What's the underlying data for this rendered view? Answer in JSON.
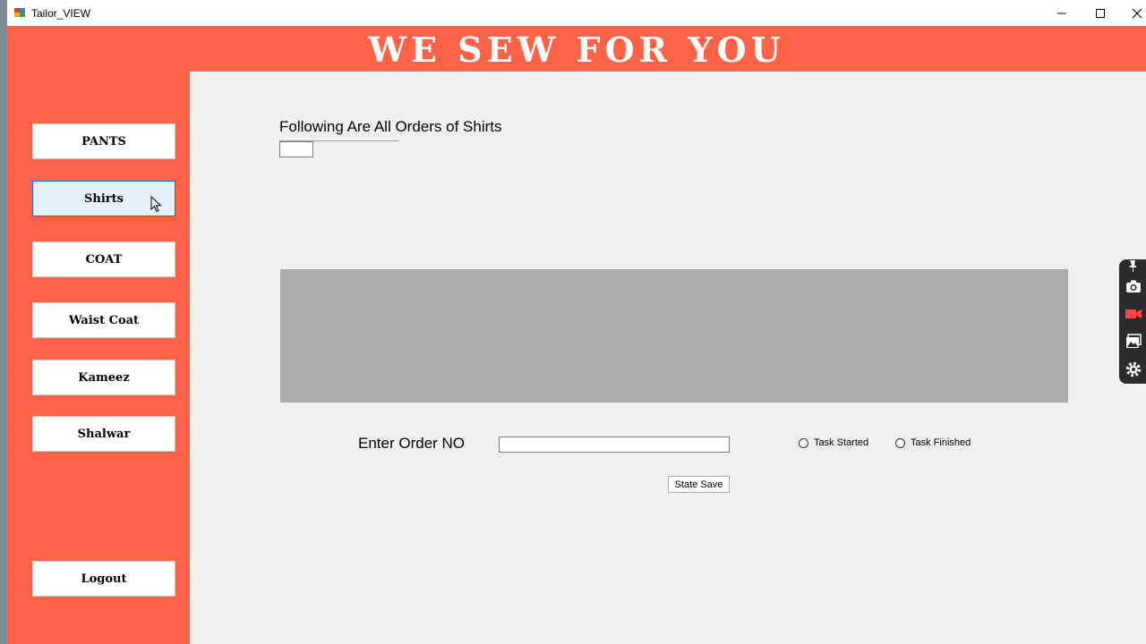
{
  "window": {
    "title": "Tailor_VIEW"
  },
  "header": {
    "title": "WE SEW FOR YOU"
  },
  "sidebar": {
    "items": [
      {
        "label": "PANTS"
      },
      {
        "label": "Shirts"
      },
      {
        "label": "COAT"
      },
      {
        "label": "Waist Coat"
      },
      {
        "label": "Kameez"
      },
      {
        "label": "Shalwar"
      }
    ],
    "logout_label": "Logout",
    "active_item": "Shirts"
  },
  "main": {
    "heading": "Following Are All Orders of Shirts",
    "order_label": "Enter Order NO",
    "order_input_value": "",
    "radio_task_started": "Task Started",
    "radio_task_finished": "Task Finished",
    "save_button": "State Save"
  },
  "colors": {
    "accent": "#ff6347",
    "grid": "#ababab"
  },
  "toolbar_icons": [
    "pin-icon",
    "camera-icon",
    "video-icon",
    "gallery-icon",
    "settings-icon"
  ]
}
